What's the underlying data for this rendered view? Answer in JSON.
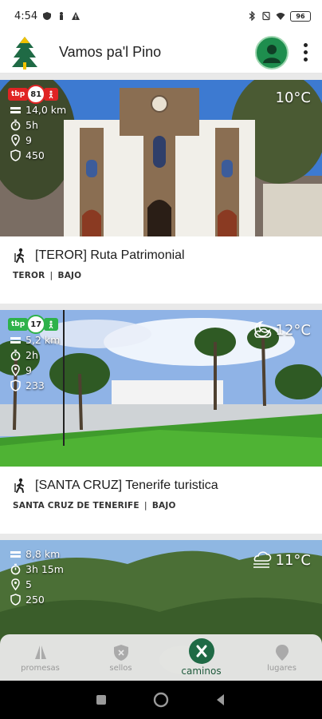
{
  "status": {
    "time": "4:54",
    "battery": "96"
  },
  "app": {
    "title": "Vamos pa'l Pino"
  },
  "cards": [
    {
      "badge_left": "tbp",
      "badge_num": "81",
      "distance": "14,0 km",
      "duration": "5h",
      "stops": "9",
      "seals": "450",
      "temperature": "10°C",
      "title": "[TEROR] Ruta Patrimonial",
      "town": "TEROR",
      "difficulty": "BAJO"
    },
    {
      "badge_left": "tbp",
      "badge_num": "17",
      "distance": "5,2 km",
      "duration": "2h",
      "stops": "9",
      "seals": "233",
      "temperature": "12°C",
      "title": "[SANTA CRUZ] Tenerife turistica",
      "town": "SANTA CRUZ DE TENERIFE",
      "difficulty": "BAJO"
    },
    {
      "distance": "8,8 km",
      "duration": "3h 15m",
      "stops": "5",
      "seals": "250",
      "temperature": "11°C"
    }
  ],
  "nav": [
    {
      "label": "promesas",
      "icon": "praying-hands-icon"
    },
    {
      "label": "sellos",
      "icon": "shield-seal-icon"
    },
    {
      "label": "caminos",
      "icon": "crossed-paths-icon",
      "active": true
    },
    {
      "label": "lugares",
      "icon": "map-pin-icon"
    }
  ],
  "colors": {
    "brand_green": "#1f6a45",
    "badge_red": "#e02424",
    "badge_green": "#2eb24a"
  }
}
